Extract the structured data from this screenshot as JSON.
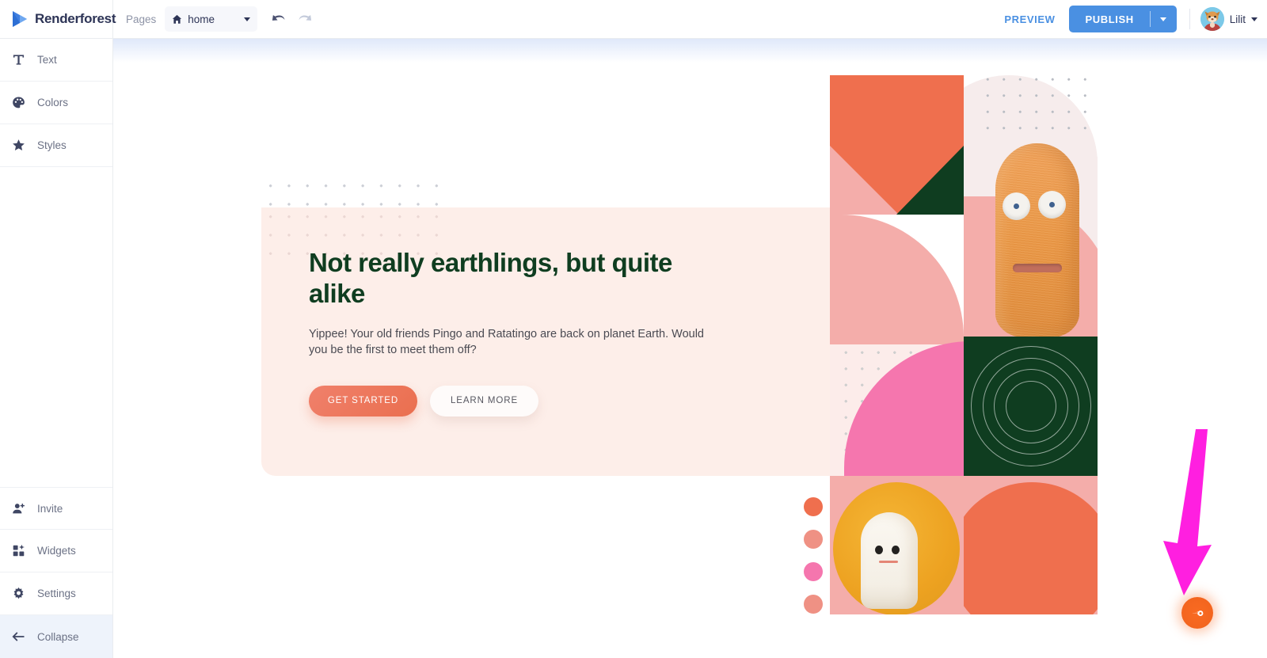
{
  "topbar": {
    "brand_name": "Renderforest",
    "brand_logo_icon": "play-triangle-logo",
    "pages_label": "Pages",
    "page_select_value": "home",
    "page_select_icon": "home-icon",
    "page_select_caret_icon": "chevron-down-icon",
    "undo_icon": "undo-arrow-icon",
    "redo_icon": "redo-arrow-icon",
    "preview_label": "PREVIEW",
    "publish_label": "PUBLISH",
    "publish_caret_icon": "chevron-down-icon",
    "user_name": "Lilit",
    "user_avatar_icon": "avatar",
    "user_caret_icon": "chevron-down-icon",
    "accent_blue": "#4a90e2",
    "text_dark": "#2d3456"
  },
  "sidebar": {
    "items": [
      {
        "label": "Text",
        "icon": "text-t-icon",
        "active": false
      },
      {
        "label": "Colors",
        "icon": "palette-icon",
        "active": false
      },
      {
        "label": "Styles",
        "icon": "star-icon",
        "active": false
      }
    ],
    "bottom_items": [
      {
        "label": "Invite",
        "icon": "user-plus-icon",
        "active": false
      },
      {
        "label": "Widgets",
        "icon": "widgets-grid-icon",
        "active": false
      },
      {
        "label": "Settings",
        "icon": "gear-icon",
        "active": false
      },
      {
        "label": "Collapse",
        "icon": "arrow-left-icon",
        "active": true
      }
    ]
  },
  "hero": {
    "title": "Not really earthlings, but quite alike",
    "subtitle": "Yippee! Your old friends Pingo and Ratatingo are back on planet Earth. Would you be the first to meet them off?",
    "primary_button": "GET STARTED",
    "secondary_button": "LEARN MORE",
    "panel_bg": "#fdeee9",
    "title_color": "#0f3d20",
    "primary_button_color": "#ea6f4f"
  },
  "collage": {
    "name": "hero-image-collage",
    "colors": {
      "orange": "#ef6f4e",
      "salmon": "#f4adaa",
      "dark_green": "#0f3d20",
      "hot_pink": "#f576ae",
      "yellow": "#eda221",
      "blush": "#f6ecec"
    },
    "characters": [
      {
        "name": "pingo-fuzzy-orange-creature"
      },
      {
        "name": "ratatingo-white-ghost-creature"
      }
    ]
  },
  "swatches": {
    "name": "color-swatch-strip",
    "colors": [
      "#ef6f4e",
      "#ef9184",
      "#f576ae",
      "#ef9184"
    ]
  },
  "annotation": {
    "arrow_color": "#ff1fe0",
    "arrow_icon": "down-arrow-annotation",
    "fab_icon": "semrush-comet-icon",
    "fab_color": "#f4661f"
  }
}
